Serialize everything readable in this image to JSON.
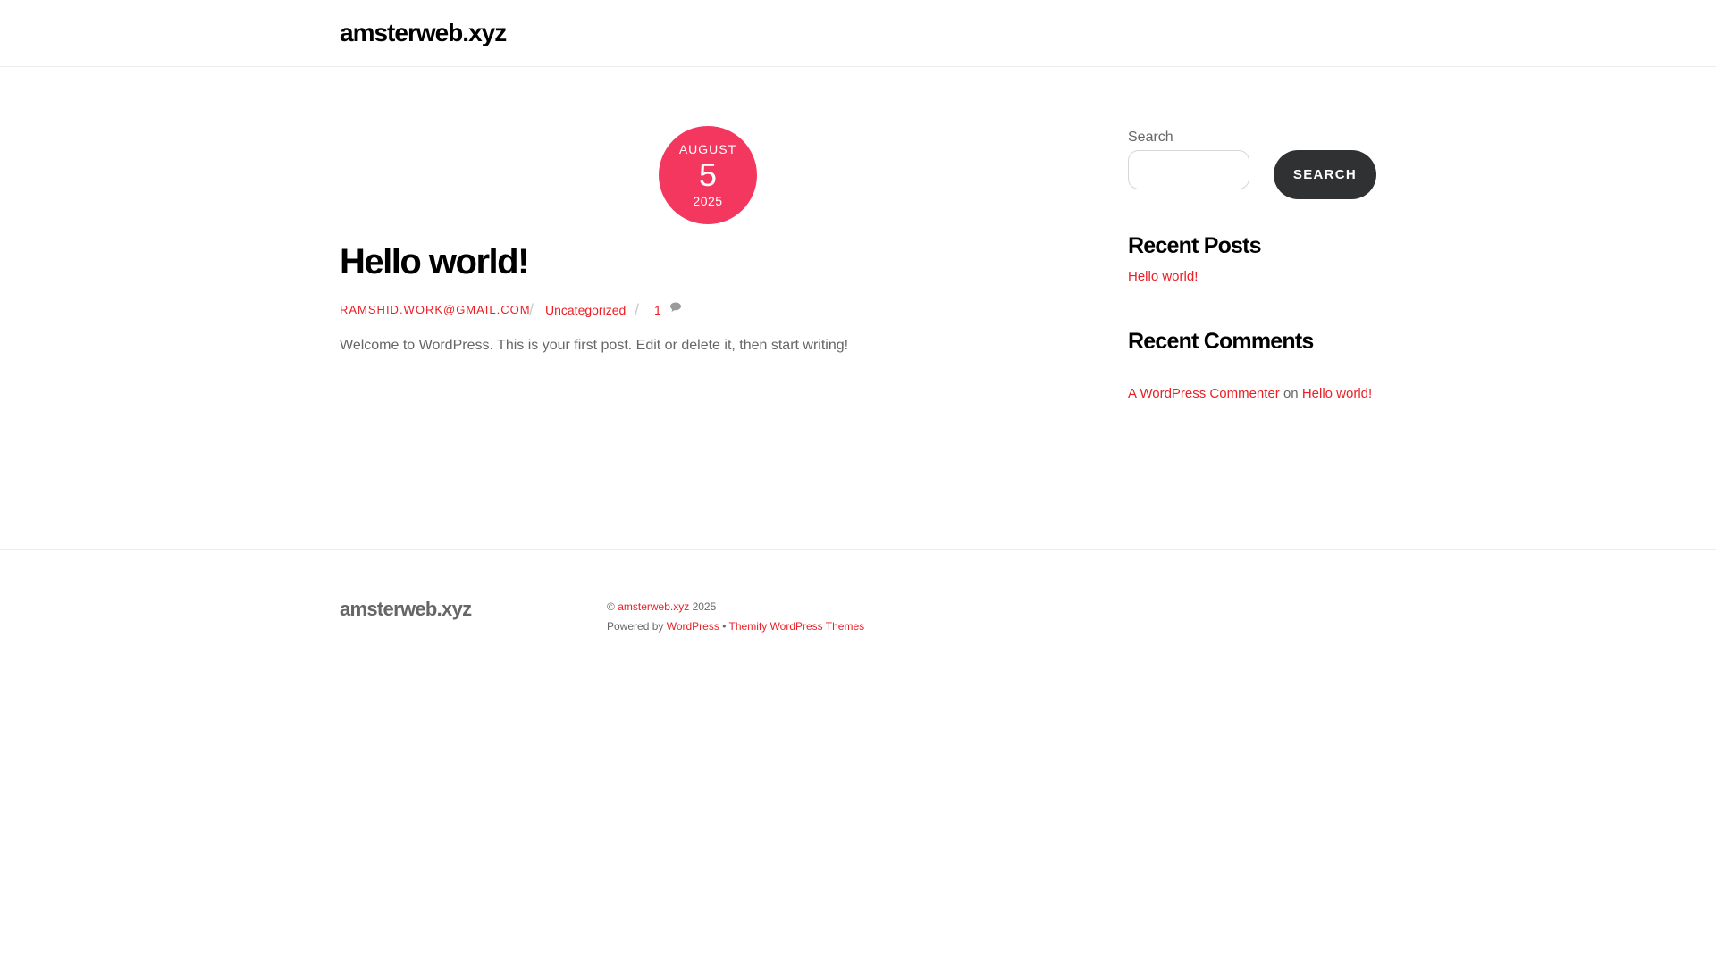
{
  "site": {
    "title": "amsterweb.xyz"
  },
  "post": {
    "date": {
      "month": "AUGUST",
      "day": "5",
      "year": "2025"
    },
    "title": "Hello world!",
    "author": "RAMSHID.WORK@GMAIL.COM",
    "separator": "/",
    "category": "Uncategorized",
    "comment_count": "1",
    "comment_icon": "speech-bubble-icon",
    "excerpt": "Welcome to WordPress. This is your first post. Edit or delete it, then start writing!"
  },
  "sidebar": {
    "search": {
      "label": "Search",
      "value": "",
      "placeholder": "",
      "button_label": "SEARCH"
    },
    "recent_posts": {
      "title": "Recent Posts",
      "items": [
        {
          "label": "Hello world!"
        }
      ]
    },
    "recent_comments": {
      "title": "Recent Comments",
      "items": [
        {
          "author": "A WordPress Commenter",
          "connector": "on",
          "post": "Hello world!"
        }
      ]
    }
  },
  "footer": {
    "site_title": "amsterweb.xyz",
    "copyright_symbol": "©",
    "copyright_link": "amsterweb.xyz",
    "copyright_year": "2025",
    "powered_by": "Powered by",
    "wordpress_link": "WordPress",
    "bullet": "•",
    "theme_link": "Themify WordPress Themes"
  },
  "colors": {
    "accent": "#ed1e24",
    "date_badge": "#f4375f",
    "button": "#2f3133",
    "text": "#666666",
    "heading": "#000000"
  }
}
